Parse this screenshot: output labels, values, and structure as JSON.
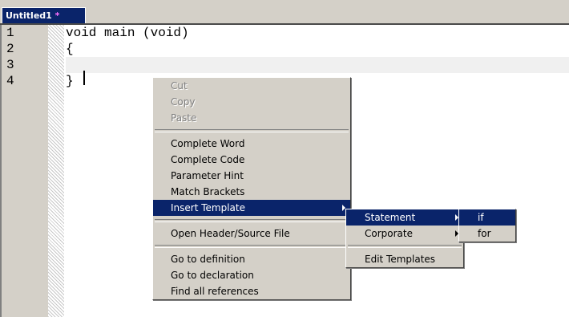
{
  "tab": {
    "title": "Untitled1",
    "modified_marker": " *"
  },
  "gutter": {
    "lines": [
      "1",
      "2",
      "3",
      "4"
    ]
  },
  "code": {
    "lines": [
      "void main (void)",
      "{",
      "",
      "}"
    ]
  },
  "context_menu": {
    "cut": "Cut",
    "copy": "Copy",
    "paste": "Paste",
    "complete_word": "Complete Word",
    "complete_code": "Complete Code",
    "parameter_hint": "Parameter Hint",
    "match_brackets": "Match Brackets",
    "insert_template": "Insert Template",
    "open_header": "Open Header/Source File",
    "go_def": "Go to definition",
    "go_decl": "Go to declaration",
    "find_refs": "Find all references"
  },
  "template_menu": {
    "statement": "Statement",
    "corporate": "Corporate",
    "edit": "Edit Templates"
  },
  "statement_menu": {
    "if": "if",
    "for": "for"
  },
  "colors": {
    "highlight": "#0a246a",
    "menu_bg": "#d4d0c8"
  }
}
